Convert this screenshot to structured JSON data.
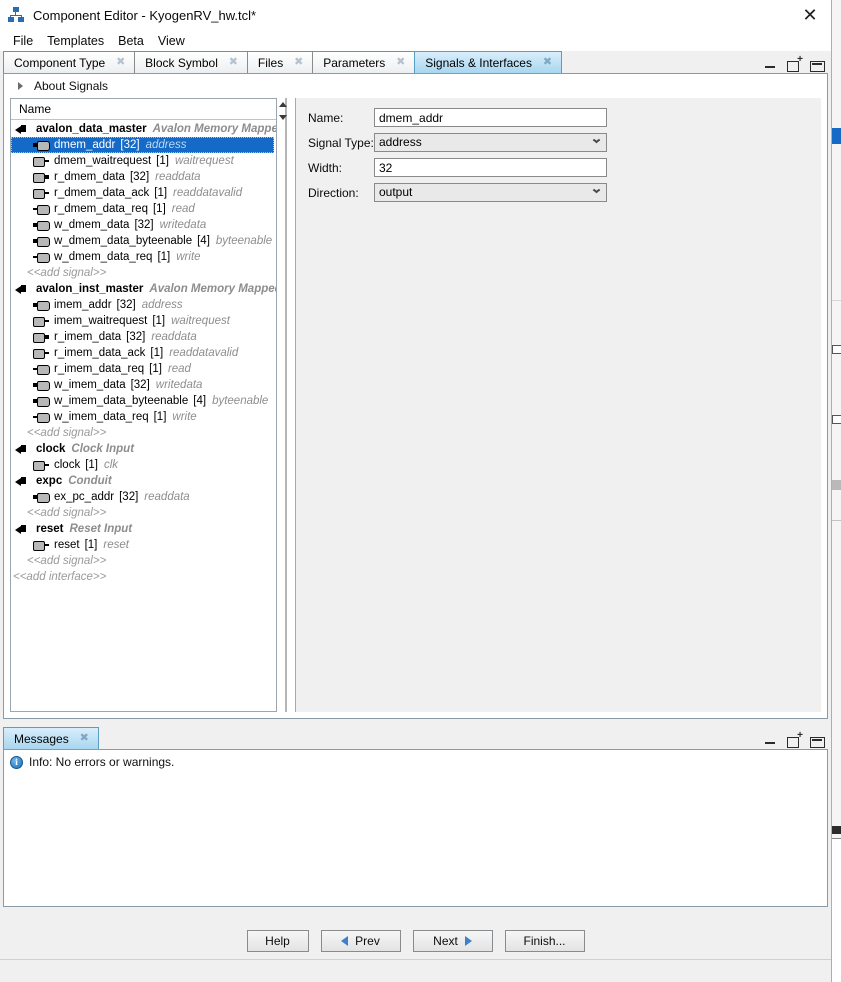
{
  "window": {
    "title": "Component Editor - KyogenRV_hw.tcl*",
    "app_icon": "hierarchy-icon",
    "close_label": "✕"
  },
  "menubar": {
    "items": [
      {
        "label": "File"
      },
      {
        "label": "Templates"
      },
      {
        "label": "Beta"
      },
      {
        "label": "View"
      }
    ]
  },
  "tabs": {
    "items": [
      {
        "label": "Component Type",
        "active": false,
        "close": "✖"
      },
      {
        "label": "Block Symbol",
        "active": false,
        "close": "✖"
      },
      {
        "label": "Files",
        "active": false,
        "close": "✖"
      },
      {
        "label": "Parameters",
        "active": false,
        "close": "✖"
      },
      {
        "label": "Signals & Interfaces",
        "active": true,
        "close": "✖"
      }
    ],
    "panel_buttons": [
      "minimize-icon",
      "restore-icon",
      "maximize-icon"
    ]
  },
  "about": {
    "label": "About Signals",
    "expander": "triangle-right-icon"
  },
  "tree": {
    "column_header": "Name",
    "add_interface_label": "<<add interface>>",
    "add_signal_label": "<<add signal>>",
    "groups": [
      {
        "name": "avalon_data_master",
        "type": "Avalon Memory Mapped",
        "icon": "interface-icon",
        "signals": [
          {
            "name": "dmem_addr",
            "width": "[32]",
            "type": "address",
            "icon": "signal-output-icon",
            "selected": true
          },
          {
            "name": "dmem_waitrequest",
            "width": "[1]",
            "type": "waitrequest",
            "icon": "signal-input-icon",
            "selected": false
          },
          {
            "name": "r_dmem_data",
            "width": "[32]",
            "type": "readdata",
            "icon": "signal-input-bus-icon",
            "selected": false
          },
          {
            "name": "r_dmem_data_ack",
            "width": "[1]",
            "type": "readdatavalid",
            "icon": "signal-input-icon",
            "selected": false
          },
          {
            "name": "r_dmem_data_req",
            "width": "[1]",
            "type": "read",
            "icon": "signal-output-line-icon",
            "selected": false
          },
          {
            "name": "w_dmem_data",
            "width": "[32]",
            "type": "writedata",
            "icon": "signal-output-icon",
            "selected": false
          },
          {
            "name": "w_dmem_data_byteenable",
            "width": "[4]",
            "type": "byteenable",
            "icon": "signal-output-icon",
            "selected": false
          },
          {
            "name": "w_dmem_data_req",
            "width": "[1]",
            "type": "write",
            "icon": "signal-output-line-icon",
            "selected": false
          }
        ],
        "has_add_signal": true
      },
      {
        "name": "avalon_inst_master",
        "type": "Avalon Memory Mapped",
        "icon": "interface-icon",
        "signals": [
          {
            "name": "imem_addr",
            "width": "[32]",
            "type": "address",
            "icon": "signal-output-icon",
            "selected": false
          },
          {
            "name": "imem_waitrequest",
            "width": "[1]",
            "type": "waitrequest",
            "icon": "signal-input-icon",
            "selected": false
          },
          {
            "name": "r_imem_data",
            "width": "[32]",
            "type": "readdata",
            "icon": "signal-input-bus-icon",
            "selected": false
          },
          {
            "name": "r_imem_data_ack",
            "width": "[1]",
            "type": "readdatavalid",
            "icon": "signal-input-icon",
            "selected": false
          },
          {
            "name": "r_imem_data_req",
            "width": "[1]",
            "type": "read",
            "icon": "signal-output-line-icon",
            "selected": false
          },
          {
            "name": "w_imem_data",
            "width": "[32]",
            "type": "writedata",
            "icon": "signal-output-icon",
            "selected": false
          },
          {
            "name": "w_imem_data_byteenable",
            "width": "[4]",
            "type": "byteenable",
            "icon": "signal-output-icon",
            "selected": false
          },
          {
            "name": "w_imem_data_req",
            "width": "[1]",
            "type": "write",
            "icon": "signal-output-line-icon",
            "selected": false
          }
        ],
        "has_add_signal": true
      },
      {
        "name": "clock",
        "type": "Clock Input",
        "icon": "interface-icon",
        "signals": [
          {
            "name": "clock",
            "width": "[1]",
            "type": "clk",
            "icon": "signal-input-icon",
            "selected": false
          }
        ],
        "has_add_signal": false
      },
      {
        "name": "expc",
        "type": "Conduit",
        "icon": "interface-icon",
        "signals": [
          {
            "name": "ex_pc_addr",
            "width": "[32]",
            "type": "readdata",
            "icon": "signal-output-icon",
            "selected": false
          }
        ],
        "has_add_signal": true
      },
      {
        "name": "reset",
        "type": "Reset Input",
        "icon": "interface-icon",
        "signals": [
          {
            "name": "reset",
            "width": "[1]",
            "type": "reset",
            "icon": "signal-input-icon",
            "selected": false
          }
        ],
        "has_add_signal": true
      }
    ]
  },
  "form": {
    "fields": [
      {
        "label": "Name:",
        "kind": "text",
        "value": "dmem_addr"
      },
      {
        "label": "Signal Type:",
        "kind": "select",
        "value": "address"
      },
      {
        "label": "Width:",
        "kind": "text",
        "value": "32"
      },
      {
        "label": "Direction:",
        "kind": "select",
        "value": "output"
      }
    ]
  },
  "messages": {
    "tab_label": "Messages",
    "tab_close": "✖",
    "entries": [
      {
        "icon": "info-icon",
        "glyph": "i",
        "text": "Info: No errors or warnings."
      }
    ],
    "panel_buttons": [
      "minimize-icon",
      "restore-icon",
      "maximize-icon"
    ]
  },
  "footer": {
    "buttons": [
      {
        "label": "Help",
        "icon": "none"
      },
      {
        "label": "Prev",
        "icon": "triangle-left-icon"
      },
      {
        "label": "Next",
        "icon": "triangle-right-icon"
      },
      {
        "label": "Finish...",
        "icon": "none"
      }
    ]
  },
  "colors": {
    "selection": "#1569c7",
    "active_tab": "#a8d6f0",
    "accent": "#3f7fd0"
  }
}
